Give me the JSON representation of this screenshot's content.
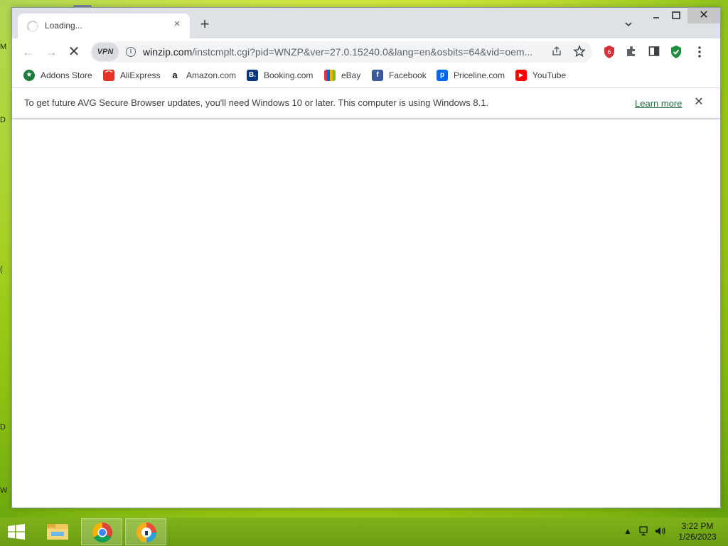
{
  "desktop": {
    "edge_letters": [
      "M",
      "D",
      "(",
      "D",
      "W"
    ]
  },
  "browser": {
    "tab": {
      "title": "Loading...",
      "close": "×"
    },
    "new_tab": "+",
    "window_controls": {
      "minimize": "–",
      "maximize": "□",
      "close": "✕"
    },
    "toolbar": {
      "back": "←",
      "forward": "→",
      "stop": "✕",
      "vpn": "VPN",
      "url_host": "winzip.com",
      "url_path": "/instcmplt.cgi?pid=WNZP&ver=27.0.15240.0&lang=en&osbits=64&vid=oem..."
    },
    "bookmarks": [
      {
        "label": "Addons Store",
        "icon": "addons-store-icon",
        "color": "#1e7b3c"
      },
      {
        "label": "AliExpress",
        "icon": "aliexpress-icon",
        "color": "#e43225"
      },
      {
        "label": "Amazon.com",
        "icon": "amazon-icon",
        "color": "#ffffff"
      },
      {
        "label": "Booking.com",
        "icon": "booking-icon",
        "color": "#003580"
      },
      {
        "label": "eBay",
        "icon": "ebay-icon",
        "color": "#ffffff"
      },
      {
        "label": "Facebook",
        "icon": "facebook-icon",
        "color": "#3b5998"
      },
      {
        "label": "Priceline.com",
        "icon": "priceline-icon",
        "color": "#0068ef"
      },
      {
        "label": "YouTube",
        "icon": "youtube-icon",
        "color": "#ff0000"
      }
    ],
    "infobar": {
      "message": "To get future AVG Secure Browser updates, you'll need Windows 10 or later. This computer is using Windows 8.1.",
      "link": "Learn more",
      "close": "✕"
    }
  },
  "taskbar": {
    "apps": [
      "file-explorer",
      "chrome",
      "avg-secure-browser"
    ],
    "clock": {
      "time": "3:22 PM",
      "date": "1/26/2023"
    }
  }
}
